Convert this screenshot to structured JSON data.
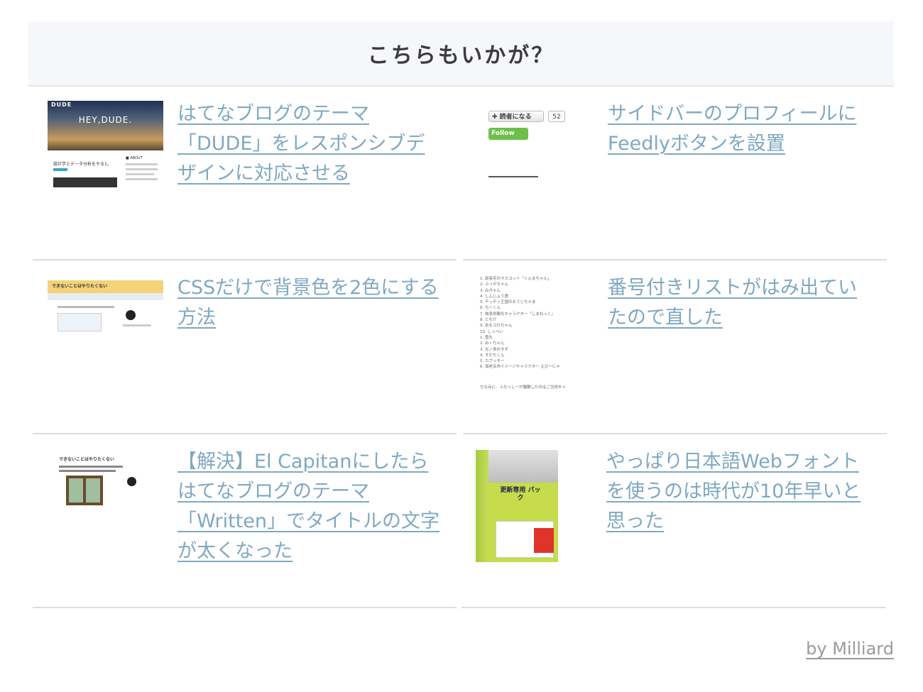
{
  "section": {
    "heading": "こちらもいかが？"
  },
  "posts": [
    {
      "title": "はてなブログのテーマ「DUDE」をレスポンシブデザインに対応させる",
      "thumb": {
        "logo": "DUDE",
        "hero_text": "HEY,DUDE.",
        "heading": "設計学とデータ分析をやる1。",
        "sidebar_heading": "■ ABOUT"
      }
    },
    {
      "title": "サイドバーのプロフィールにFeedlyボタンを設置",
      "thumb": {
        "reader_label": "✚ 読者になる",
        "reader_count": "52",
        "follow_label": "Follow"
      }
    },
    {
      "title": "CSSだけで背景色を2色にする方法",
      "thumb": {
        "blog_title": "できないことはやりたくない"
      }
    },
    {
      "title": "番号付きリストがはみ出ていたので直した",
      "thumb": {
        "items": [
          "1. 部長宅のマスコット「ぐんまちゃん」",
          "2. ふっかちゃん",
          "3. みきゃん",
          "4. しんじょう君",
          "5. チッチッ王国のおうじちゃま",
          "6. ちーくん",
          "7. 岐阜県観光キャラクター「しまねっこ」",
          "8. とち介",
          "9. 赤もコロちゃん",
          "10. しっぺい",
          "1. 雪丸",
          "2. みくちゃん",
          "3. 光ノ表のすず",
          "4. すだちくん",
          "5. カブッキー",
          "6. 海老名市イメージキャラクター えびーにゃ"
        ],
        "footer": "ちなみに、ふなっしーが優勝したのはご当地キャ"
      }
    },
    {
      "title": "【解決】El Capitanにしたらはてなブログのテーマ「Written」でタイトルの文字が太くなった",
      "thumb": {
        "blog_title": "できないことはやりたくない"
      }
    },
    {
      "title": "やっぱり日本語Webフォントを使うのは時代が10年早いと思った",
      "thumb": {
        "box_label": "更新専用 パック"
      }
    }
  ],
  "credit": "by Milliard",
  "colors": {
    "link": "#7fa8c1",
    "header_bg": "#f6f7fa",
    "divider": "#dcdcdc"
  }
}
